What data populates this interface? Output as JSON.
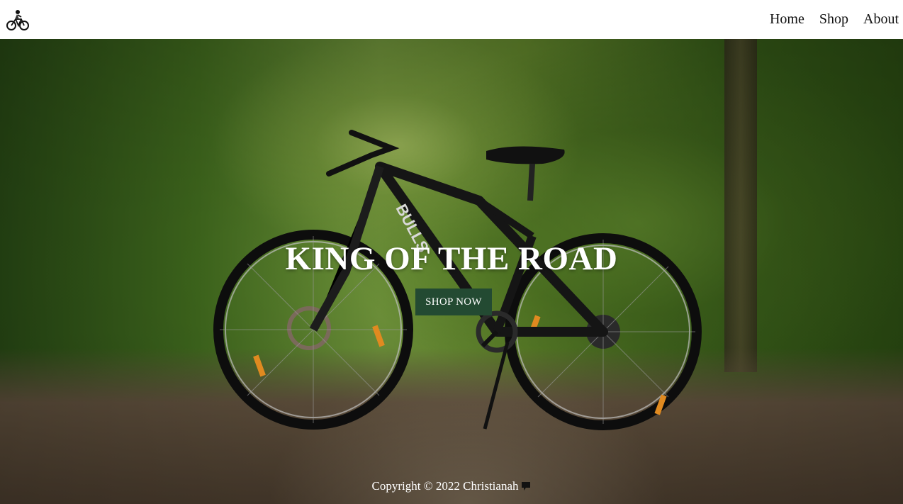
{
  "navbar": {
    "logo_icon": "cyclist-icon",
    "links": [
      {
        "label": "Home"
      },
      {
        "label": "Shop"
      },
      {
        "label": "About"
      }
    ]
  },
  "hero": {
    "background": "bicycle-on-forest-path",
    "title": "KING OF THE ROAD",
    "button_label": "SHOP NOW",
    "button_color": "#234a32"
  },
  "footer": {
    "text": "Copyright © 2022 Christianah",
    "icon": "speech-bubble-icon"
  }
}
